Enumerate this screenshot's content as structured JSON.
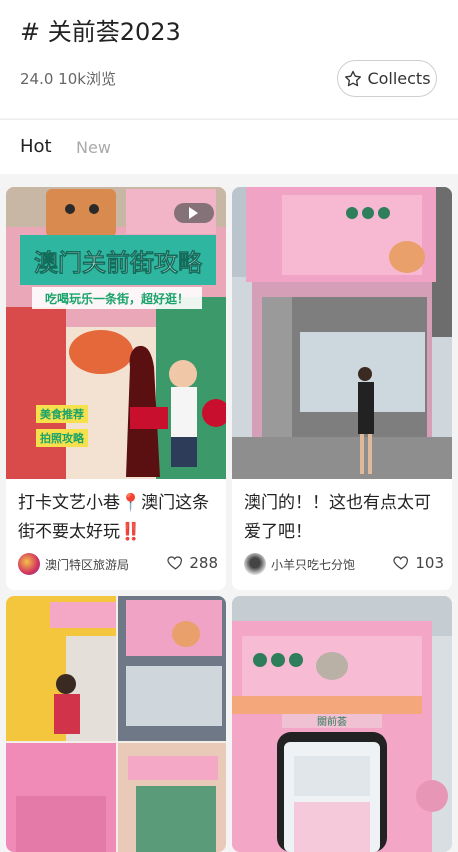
{
  "header": {
    "title": "# 关前荟2023",
    "views": "24.0 10k浏览",
    "collect_label": "Collects"
  },
  "tabs": [
    {
      "label": "Hot",
      "active": true
    },
    {
      "label": "New",
      "active": false
    }
  ],
  "posts": [
    {
      "image_text": {
        "headline": "澳门关前街攻略",
        "subline": "吃喝玩乐一条街，超好逛！",
        "tag1": "美食推荐",
        "tag2": "拍照攻略"
      },
      "title": "打卡文艺小巷📍澳门这条街不要太好玩‼️",
      "author": "澳门特区旅游局",
      "likes": "288"
    },
    {
      "image_text": {},
      "title": "澳门的！！这也有点太可爱了吧！",
      "author": "小羊只吃七分饱",
      "likes": "103"
    },
    {
      "image_text": {},
      "title": "",
      "author": "",
      "likes": ""
    },
    {
      "image_text": {
        "sign": "關前荟"
      },
      "title": "",
      "author": "",
      "likes": ""
    }
  ],
  "colors": {
    "accent_pink": "#ee8fb8",
    "headline_green": "#1aa36a",
    "muted_text": "#999999"
  }
}
